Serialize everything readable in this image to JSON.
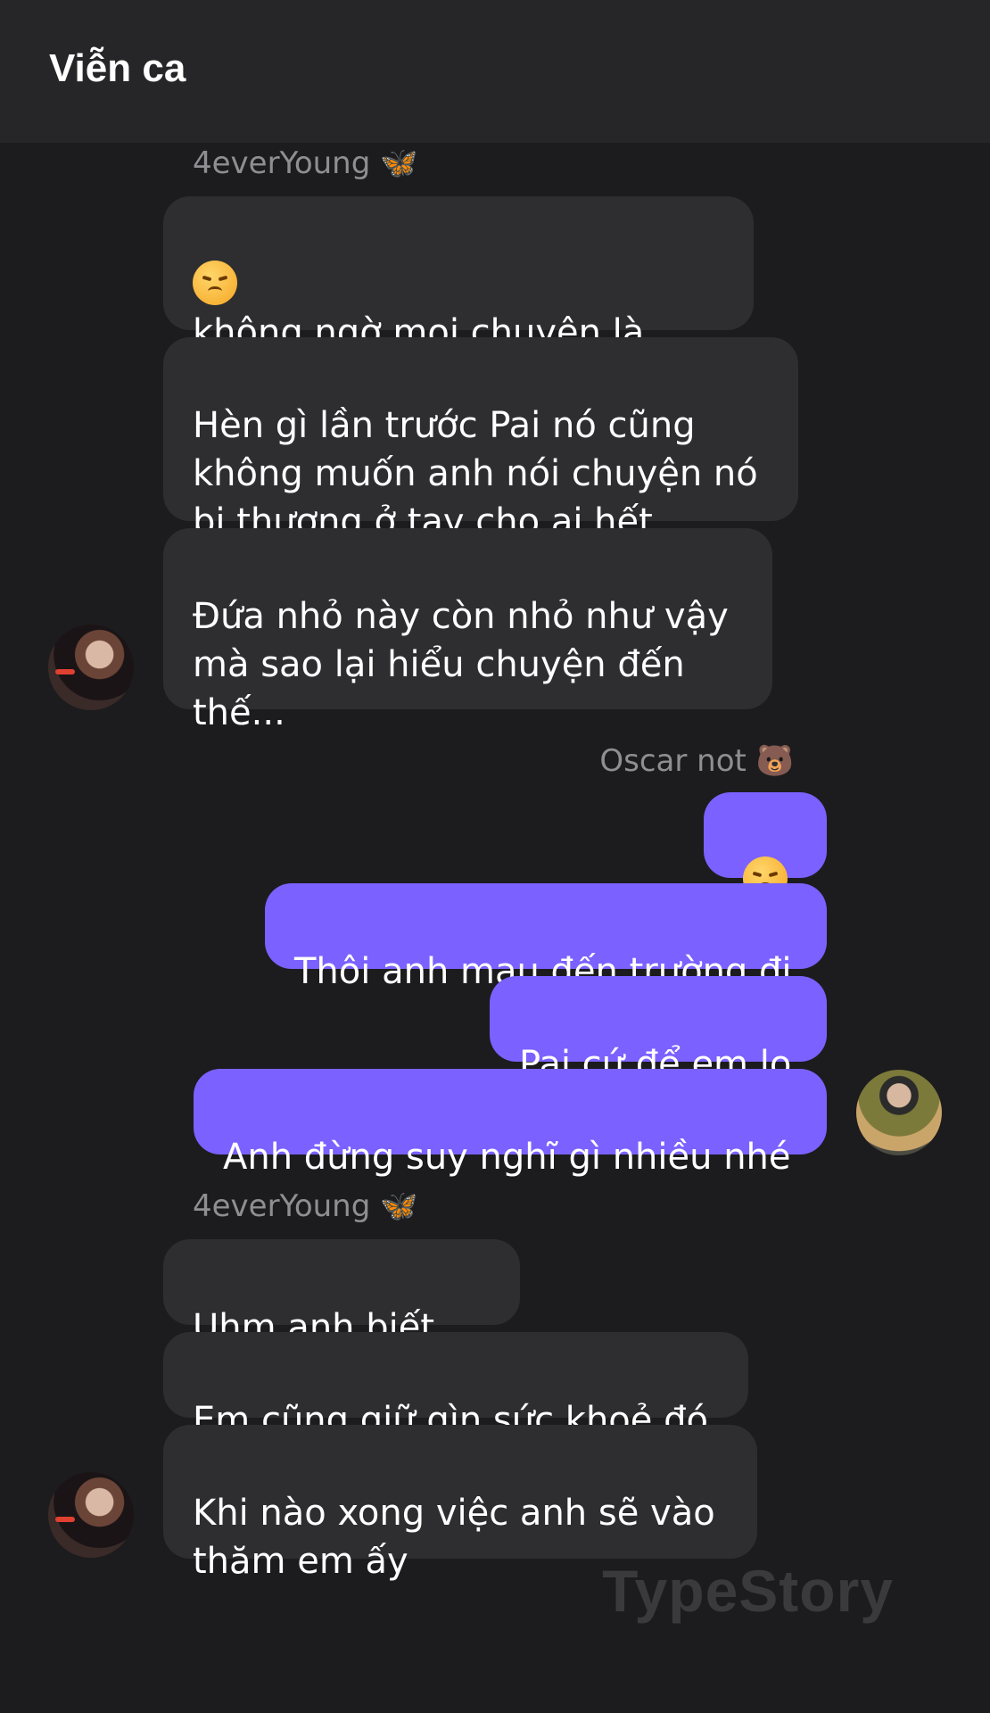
{
  "header": {
    "title": "Viễn ca"
  },
  "contacts": {
    "incoming_name": "4everYoung 🦋",
    "outgoing_name": "Oscar not 🐻"
  },
  "messages": {
    "group1": [
      "không ngờ mọi chuyện là\nnhư vậy",
      "Hèn gì lần trước Pai nó cũng\nkhông muốn anh nói chuyện nó\nbị thương ở tay cho ai hết",
      "Đứa nhỏ này còn nhỏ như vậy\nmà sao lại hiểu chuyện đến\nthế..."
    ],
    "group2": [
      "",
      "Thôi anh mau đến trường đi",
      "Pai cứ để em lo",
      "Anh đừng suy nghĩ gì nhiều nhé"
    ],
    "group3": [
      "Uhm anh biết rồi",
      "Em cũng giữ gìn sức khoẻ đó",
      "Khi nào xong việc anh sẽ vào\nthăm em ấy"
    ]
  },
  "emoji": {
    "disappointed": "disappointed-face"
  },
  "watermark": "TypeStory",
  "colors": {
    "background": "#1c1c1e",
    "header": "#262628",
    "incoming_bubble": "#2e2e30",
    "outgoing_bubble": "#7b61ff",
    "sender_name": "#8e8e93",
    "watermark": "#3a3a3c"
  }
}
